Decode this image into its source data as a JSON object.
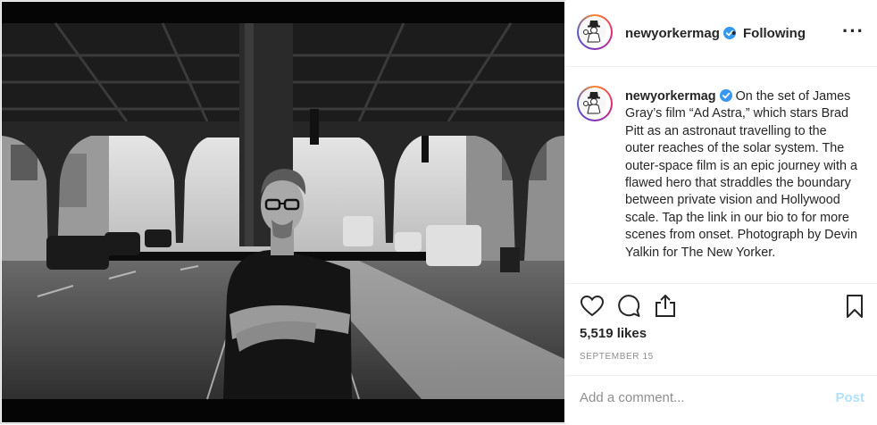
{
  "post": {
    "username": "newyorkermag",
    "separator": "•",
    "follow_status": "Following",
    "more_icon": "more-options-icon",
    "caption_username": "newyorkermag",
    "caption_text": " On the set of James Gray’s film “Ad Astra,” which stars Brad Pitt as an astronaut travelling to the outer reaches of the solar system. The outer-space film is an epic journey with a flawed hero that straddles the boundary between private vision and Hollywood scale. Tap the link in our bio to for more scenes from onset. Photograph by Devin Yalkin for The New Yorker.",
    "likes": "5,519 likes",
    "date": "SEPTEMBER 15",
    "comment_placeholder": "Add a comment...",
    "post_button": "Post"
  },
  "colors": {
    "verified_badge": "#3897f0",
    "post_button_disabled": "#b2dffc",
    "muted_text": "#8e8e8e"
  },
  "icons": [
    "heart-icon",
    "comment-icon",
    "share-icon",
    "bookmark-icon",
    "verified-badge-icon"
  ]
}
